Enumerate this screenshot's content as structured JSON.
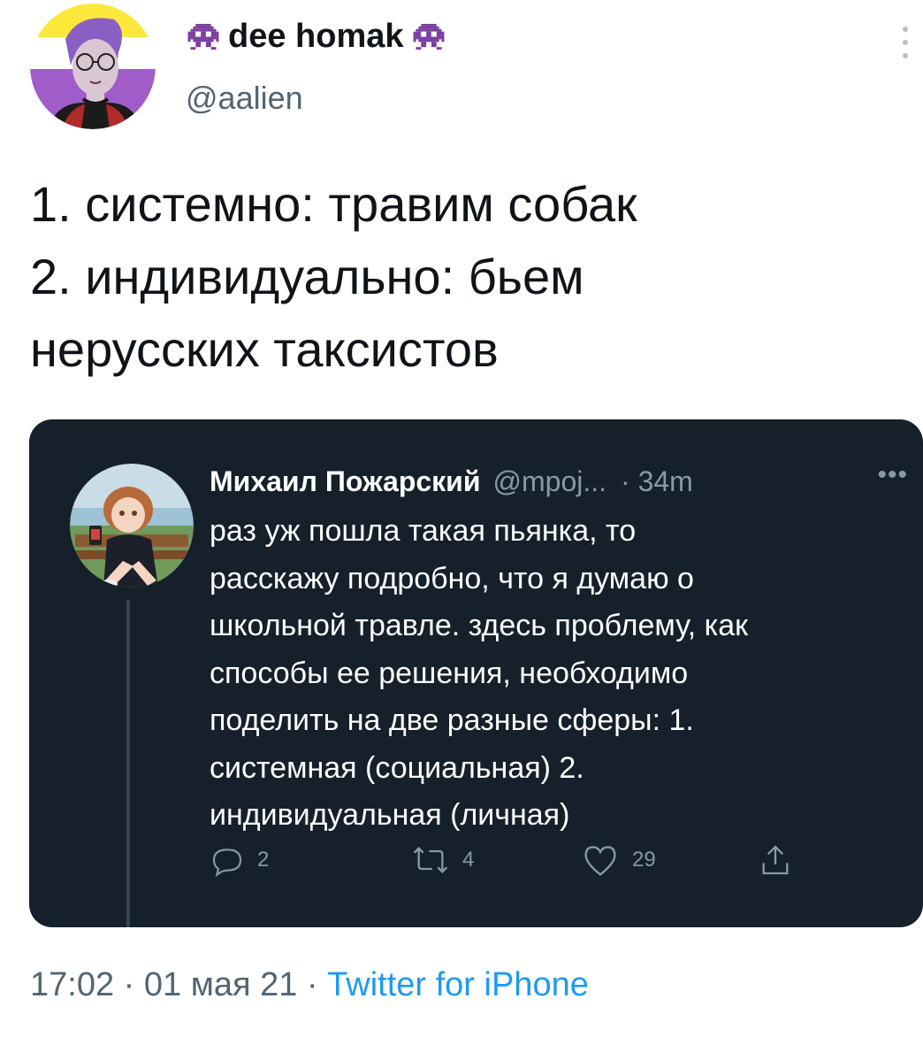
{
  "author": {
    "display_name": "dee homak",
    "handle": "@aalien",
    "name_emoji_left": "alien-monster-icon",
    "name_emoji_right": "alien-monster-icon"
  },
  "tweet": {
    "lines": [
      "1. системно: травим собак",
      "2. индивидуально: бьем",
      "нерусских таксистов"
    ]
  },
  "quoted": {
    "name": "Михаил Пожарский",
    "handle": "@mpoj...",
    "time": "· 34m",
    "more": "•••",
    "lines": [
      "раз уж пошла такая пьянка, то",
      "расскажу подробно, что я думаю о",
      "школьной травле. здесь проблему, как",
      "способы ее решения, необходимо",
      "поделить на две разные сферы: 1.",
      "системная (социальная) 2.",
      "индивидуальная (личная)"
    ],
    "actions": {
      "replies": "2",
      "retweets": "4",
      "likes": "29"
    }
  },
  "footer": {
    "time": "17:02",
    "separator1": " · ",
    "date": "01 мая 21",
    "separator2": " · ",
    "source": "Twitter for iPhone"
  },
  "colors": {
    "card_bg": "#15202b",
    "link": "#1d9bf0",
    "muted": "#536471",
    "alien": "#7b3fa0"
  }
}
